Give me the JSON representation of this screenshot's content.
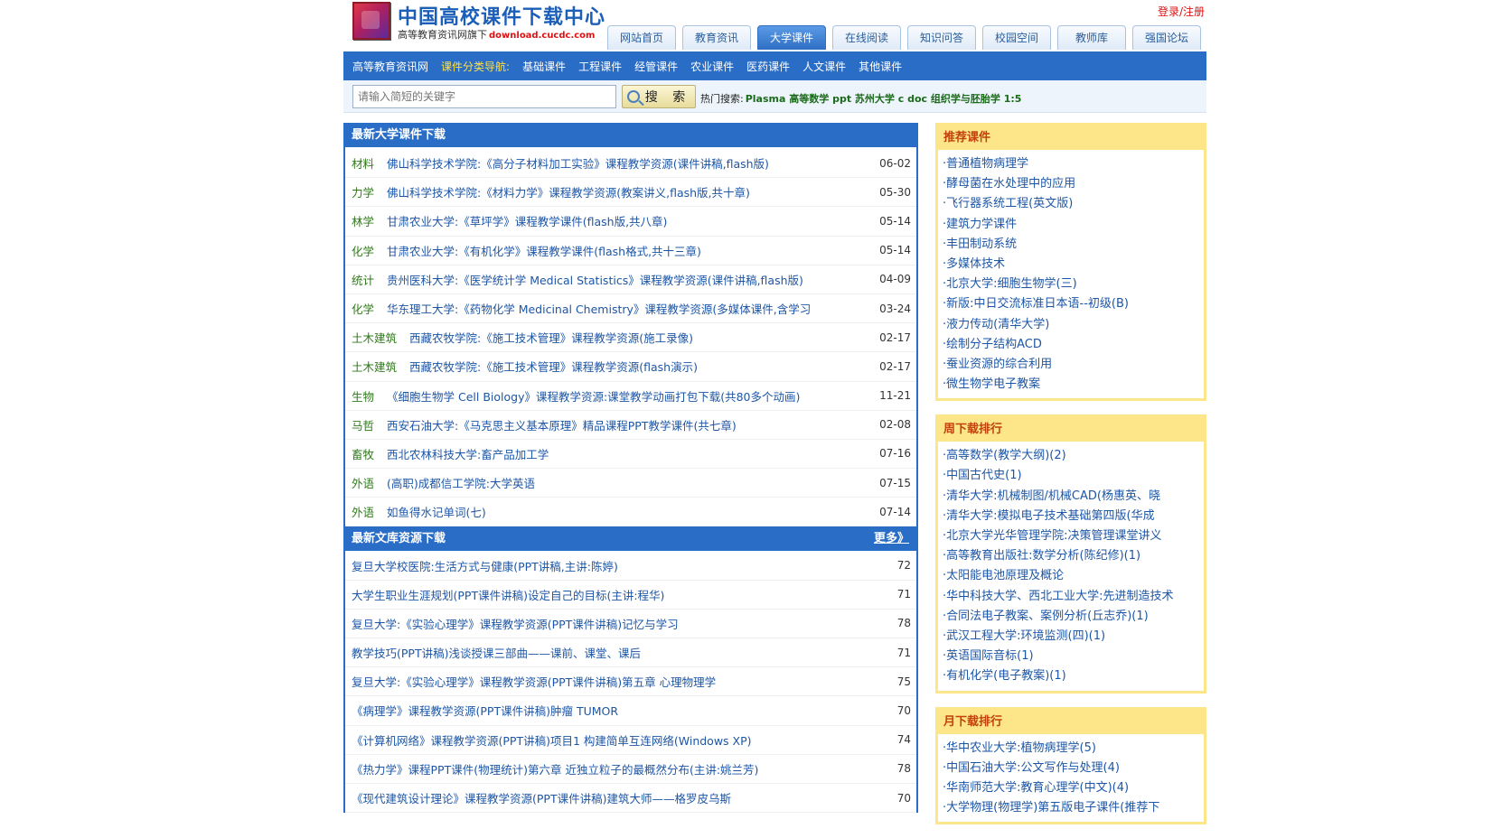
{
  "header": {
    "site_title": "中国高校课件下载中心",
    "site_sub": "高等教育资讯网旗下",
    "site_domain": "download.cucdc.com",
    "login": "登录/注册",
    "tabs": [
      "网站首页",
      "教育资讯",
      "大学课件",
      "在线阅读",
      "知识问答",
      "校园空间",
      "教师库",
      "强国论坛"
    ],
    "active_tab": "大学课件"
  },
  "nav": {
    "home": "高等教育资讯网",
    "label": "课件分类导航:",
    "items": [
      "基础课件",
      "工程课件",
      "经管课件",
      "农业课件",
      "医药课件",
      "人文课件",
      "其他课件"
    ]
  },
  "search": {
    "placeholder": "请输入简短的关键字",
    "button": "搜 索",
    "hot_label": "热门搜索:",
    "hot_terms": "Plasma 高等数学 ppt 苏州大学 c doc 组织学与胚胎学 1:5"
  },
  "latest_courses": {
    "title": "最新大学课件下载",
    "rows": [
      {
        "cat": "材料",
        "title": "佛山科学技术学院:《高分子材料加工实验》课程教学资源(课件讲稿,flash版)",
        "date": "06-02"
      },
      {
        "cat": "力学",
        "title": "佛山科学技术学院:《材料力学》课程教学资源(教案讲义,flash版,共十章)",
        "date": "05-30"
      },
      {
        "cat": "林学",
        "title": "甘肃农业大学:《草坪学》课程教学课件(flash版,共八章)",
        "date": "05-14"
      },
      {
        "cat": "化学",
        "title": "甘肃农业大学:《有机化学》课程教学课件(flash格式,共十三章)",
        "date": "05-14"
      },
      {
        "cat": "统计",
        "title": "贵州医科大学:《医学统计学 Medical Statistics》课程教学资源(课件讲稿,flash版)",
        "date": "04-09"
      },
      {
        "cat": "化学",
        "title": "华东理工大学:《药物化学 Medicinal Chemistry》课程教学资源(多媒体课件,含学习",
        "date": "03-24"
      },
      {
        "cat": "土木建筑",
        "title": "西藏农牧学院:《施工技术管理》课程教学资源(施工录像)",
        "date": "02-17"
      },
      {
        "cat": "土木建筑",
        "title": "西藏农牧学院:《施工技术管理》课程教学资源(flash演示)",
        "date": "02-17"
      },
      {
        "cat": "生物",
        "title": "《细胞生物学 Cell Biology》课程教学资源:课堂教学动画打包下载(共80多个动画)",
        "date": "11-21"
      },
      {
        "cat": "马哲",
        "title": "西安石油大学:《马克思主义基本原理》精品课程PPT教学课件(共七章)",
        "date": "02-08"
      },
      {
        "cat": "畜牧",
        "title": "西北农林科技大学:畜产品加工学",
        "date": "07-16"
      },
      {
        "cat": "外语",
        "title": "(高职)成都信工学院:大学英语",
        "date": "07-15"
      },
      {
        "cat": "外语",
        "title": "如鱼得水记单词(七)",
        "date": "07-14"
      }
    ]
  },
  "latest_docs": {
    "title": "最新文库资源下载",
    "more": "更多》",
    "rows": [
      {
        "title": "复旦大学校医院:生活方式与健康(PPT讲稿,主讲:陈婷)",
        "num": "72"
      },
      {
        "title": "大学生职业生涯规划(PPT课件讲稿)设定自己的目标(主讲:程华)",
        "num": "71"
      },
      {
        "title": "复旦大学:《实验心理学》课程教学资源(PPT课件讲稿)记忆与学习",
        "num": "78"
      },
      {
        "title": "教学技巧(PPT讲稿)浅谈授课三部曲——课前、课堂、课后",
        "num": "71"
      },
      {
        "title": "复旦大学:《实验心理学》课程教学资源(PPT课件讲稿)第五章 心理物理学",
        "num": "75"
      },
      {
        "title": "《病理学》课程教学资源(PPT课件讲稿)肿瘤 TUMOR",
        "num": "70"
      },
      {
        "title": "《计算机网络》课程教学资源(PPT讲稿)项目1 构建简单互连网络(Windows XP)",
        "num": "74"
      },
      {
        "title": "《热力学》课程PPT课件(物理统计)第六章 近独立粒子的最概然分布(主讲:姚兰芳)",
        "num": "78"
      },
      {
        "title": "《现代建筑设计理论》课程教学资源(PPT课件讲稿)建筑大师——格罗皮乌斯",
        "num": "70"
      }
    ]
  },
  "recommended": {
    "title": "推荐课件",
    "items": [
      "·普通植物病理学",
      "·酵母菌在水处理中的应用",
      "·飞行器系统工程(英文版)",
      "·建筑力学课件",
      "·丰田制动系统",
      "·多媒体技术",
      "·北京大学:细胞生物学(三)",
      "·新版:中日交流标准日本语--初级(B)",
      "·液力传动(清华大学)",
      "·绘制分子结构ACD",
      "·蚕业资源的综合利用",
      "·微生物学电子教案"
    ]
  },
  "weekly": {
    "title": "周下载排行",
    "items": [
      "·高等数学(教学大纲)(2)",
      "·中国古代史(1)",
      "·清华大学:机械制图/机械CAD(杨惠英、晓",
      "·清华大学:模拟电子技术基础第四版(华成",
      "·北京大学光华管理学院:决策管理课堂讲义",
      "·高等教育出版社:数学分析(陈纪修)(1)",
      "·太阳能电池原理及概论",
      "·华中科技大学、西北工业大学:先进制造技术",
      "·合同法电子教案、案例分析(丘志乔)(1)",
      "·武汉工程大学:环境监测(四)(1)",
      "·英语国际音标(1)",
      "·有机化学(电子教案)(1)"
    ]
  },
  "monthly": {
    "title": "月下载排行",
    "items": [
      "·华中农业大学:植物病理学(5)",
      "·中国石油大学:公文写作与处理(4)",
      "·华南师范大学:教育心理学(中文)(4)",
      "·大学物理(物理学)第五版电子课件(推荐下"
    ]
  }
}
